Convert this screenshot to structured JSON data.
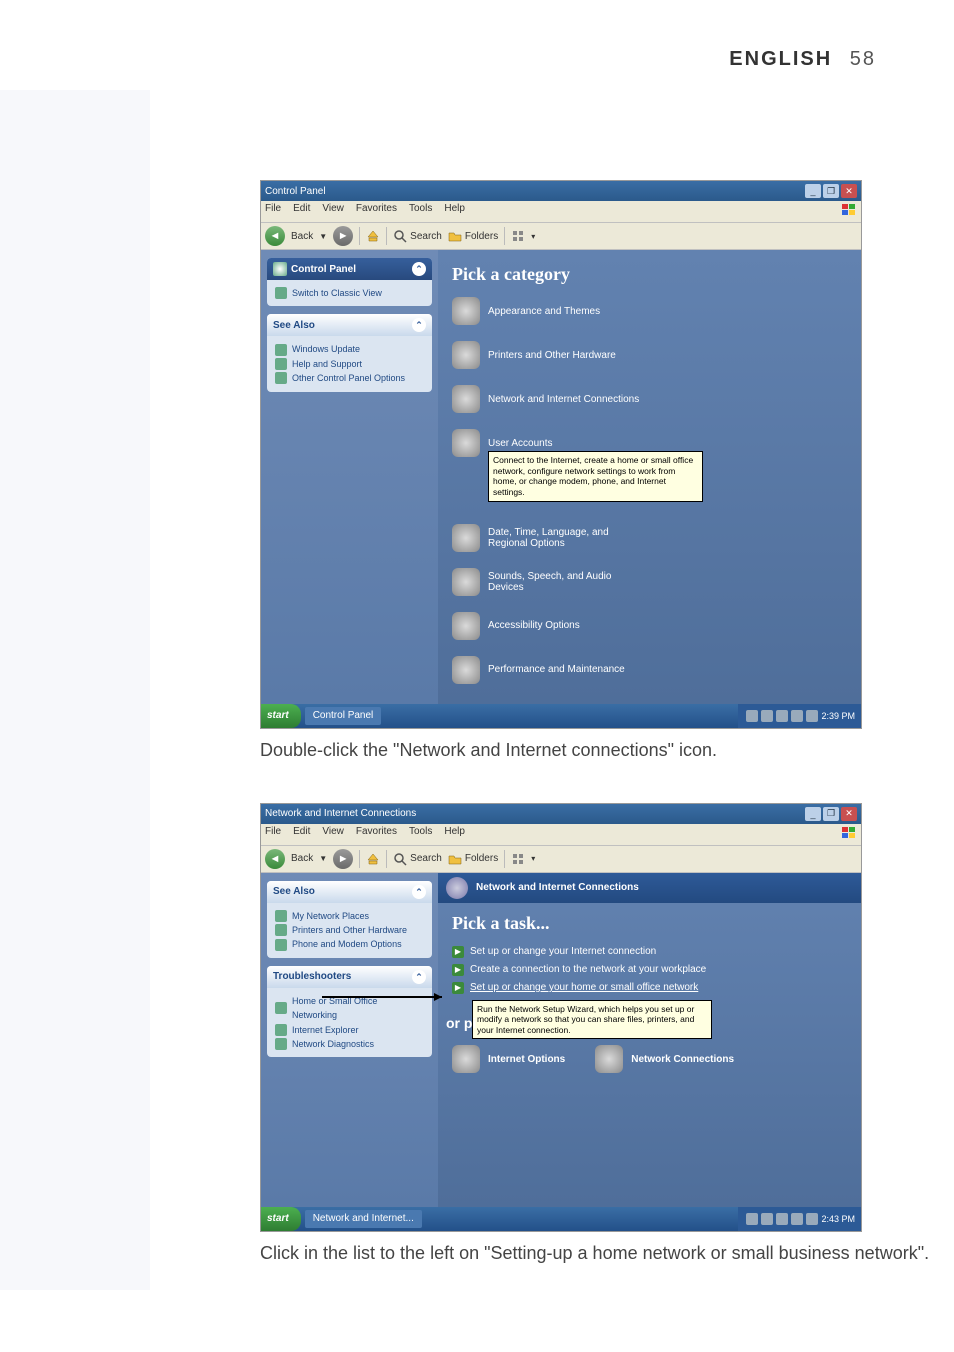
{
  "header": {
    "lang": "ENGLISH",
    "page_number": "58"
  },
  "shot1": {
    "title": "Control Panel",
    "menubar": [
      "File",
      "Edit",
      "View",
      "Favorites",
      "Tools",
      "Help"
    ],
    "toolbar": {
      "back": "Back",
      "search": "Search",
      "folders": "Folders"
    },
    "side_main": {
      "title": "Control Panel",
      "switch": "Switch to Classic View"
    },
    "see_also": {
      "title": "See Also",
      "items": [
        "Windows Update",
        "Help and Support",
        "Other Control Panel Options"
      ]
    },
    "heading": "Pick a category",
    "categories": {
      "appearance": "Appearance and Themes",
      "printers": "Printers and Other Hardware",
      "network": "Network and Internet Connections",
      "users": "User Accounts",
      "date": "Date, Time, Language, and Regional Options",
      "sounds": "Sounds, Speech, and Audio Devices",
      "access": "Accessibility Options",
      "perf": "Performance and Maintenance"
    },
    "tooltip": "Connect to the Internet, create a home or small office network, configure network settings to work from home, or change modem, phone, and Internet settings.",
    "taskbar": {
      "start": "start",
      "task": "Control Panel",
      "clock": "2:39 PM"
    }
  },
  "caption1": "Double-click the \"Network and Internet connections\" icon.",
  "shot2": {
    "title": "Network and Internet Connections",
    "menubar": [
      "File",
      "Edit",
      "View",
      "Favorites",
      "Tools",
      "Help"
    ],
    "toolbar": {
      "back": "Back",
      "search": "Search",
      "folders": "Folders"
    },
    "see_also": {
      "title": "See Also",
      "items": [
        "My Network Places",
        "Printers and Other Hardware",
        "Phone and Modem Options"
      ]
    },
    "troubleshooters": {
      "title": "Troubleshooters",
      "items": [
        "Home or Small Office Networking",
        "Internet Explorer",
        "Network Diagnostics"
      ]
    },
    "banner": "Network and Internet Connections",
    "pick": "Pick a task...",
    "tasks": [
      "Set up or change your Internet connection",
      "Create a connection to the network at your workplace",
      "Set up or change your home or small office network"
    ],
    "tooltip": "Run the Network Setup Wizard, which helps you set up or modify a network so that you can share files, printers, and your Internet connection.",
    "or": "or pi",
    "icons": {
      "inet": "Internet Options",
      "netconn": "Network Connections"
    },
    "taskbar": {
      "start": "start",
      "task": "Network and Internet...",
      "clock": "2:43 PM"
    }
  },
  "caption2": "Click in the list to the left on \"Setting-up a home network or small business network\"."
}
